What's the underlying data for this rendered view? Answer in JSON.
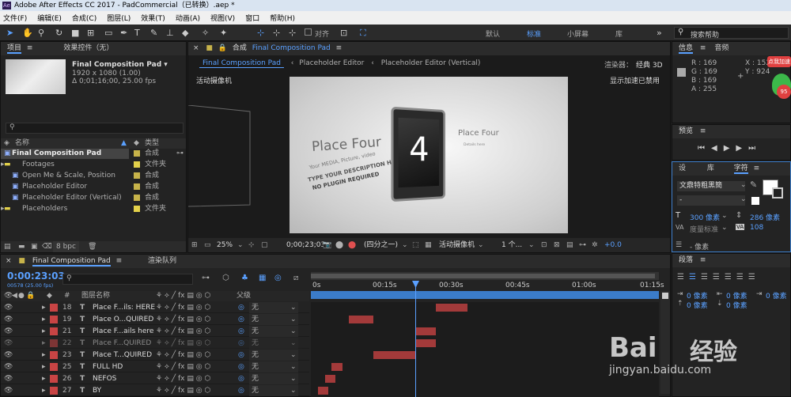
{
  "window": {
    "title": "Adobe After Effects CC 2017 - PadCommercial（已转换）.aep *"
  },
  "menu": [
    "文件(F)",
    "编辑(E)",
    "合成(C)",
    "图层(L)",
    "效果(T)",
    "动画(A)",
    "视图(V)",
    "窗口",
    "帮助(H)"
  ],
  "toolbar": {
    "align_label": "对齐",
    "workspaces": [
      "默认",
      "标准",
      "小屏幕",
      "库"
    ],
    "search_placeholder": "搜索帮助"
  },
  "project": {
    "tab_project": "项目",
    "tab_effects": "效果控件（无）",
    "comp_name": "Final Composition Pad ▾",
    "comp_res": "1920 x 1080 (1.00)",
    "comp_dur": "Δ 0;01;16;00, 25.00 fps",
    "col_name": "名称",
    "col_type": "类型",
    "bpc": "8 bpc",
    "items": [
      {
        "name": "Final Composition Pad",
        "type": "合成",
        "color": "#c7b34a"
      },
      {
        "name": "Footages",
        "type": "文件夹",
        "color": "#e3d14a"
      },
      {
        "name": "Open Me & Scale, Position",
        "type": "合成",
        "color": "#c7b34a"
      },
      {
        "name": "Placeholder Editor",
        "type": "合成",
        "color": "#c7b34a"
      },
      {
        "name": "Placeholder Editor (Vertical)",
        "type": "合成",
        "color": "#c7b34a"
      },
      {
        "name": "Placeholders",
        "type": "文件夹",
        "color": "#e3d14a"
      }
    ]
  },
  "viewer": {
    "comp_label": "合成",
    "comp_tab": "Final Composition Pad",
    "crumb1": "Placeholder Editor",
    "crumb2": "Placeholder Editor (Vertical)",
    "renderer": "渲染器：",
    "renderer_value": "经典 3D",
    "camera_label": "活动摄像机",
    "accel_label": "显示加速已禁用",
    "canvas": {
      "place_four_big": "Place Four",
      "line1": "Your MEDIA, Picture, video",
      "line2": "TYPE YOUR DESCRIPTION HERE",
      "line3": "NO PLUGIN REQUIRED",
      "digit": "4",
      "place_four_small": "Place Four",
      "details": "Details here"
    },
    "footer": {
      "zoom": "25%",
      "time": "0;00;23;03",
      "resolution": "(四分之一)",
      "camera": "活动摄像机",
      "views": "1 个...",
      "offset": "+0.0"
    }
  },
  "info": {
    "tab_info": "信息",
    "tab_audio": "音频",
    "r": "R : 169",
    "g": "G : 169",
    "b": "B : 169",
    "a": "A : 255",
    "x": "X : 152",
    "y": "Y : 924"
  },
  "preview": {
    "title": "预览"
  },
  "character": {
    "tab1": "设",
    "tab2": "库",
    "tab3": "字符",
    "font": "文鼎特粗黑簡",
    "style": "-",
    "size": "300 像素",
    "leading": "286 像素",
    "kerning": "度量标准",
    "tracking": "108",
    "stroke": "- 像素"
  },
  "paragraph": {
    "title": "段落",
    "v1": "0 像素",
    "v2": "0 像素",
    "v3": "0 像素",
    "v4": "0 像素",
    "v5": "0 像素"
  },
  "timeline": {
    "tab": "Final Composition Pad",
    "tab2": "渲染队列",
    "time": "0:00:23:03",
    "frames": "00578 (25.00 fps)",
    "col_layer": "图层名称",
    "col_parent": "父级",
    "ruler": [
      "0s",
      "00:15s",
      "00:30s",
      "00:45s",
      "01:00s",
      "01:15s"
    ],
    "layers": [
      {
        "num": "18",
        "name": "Place F...ils: HERE",
        "parent": "无",
        "bar_start": 0.36,
        "bar_end": 0.45
      },
      {
        "num": "19",
        "name": "Place O...QUIRED",
        "parent": "无",
        "bar_start": 0.11,
        "bar_end": 0.18
      },
      {
        "num": "21",
        "name": "Place F...ails here",
        "parent": "无",
        "bar_start": 0.3,
        "bar_end": 0.36
      },
      {
        "num": "22",
        "name": "Place F...QUIRED",
        "parent": "无",
        "bar_start": 0.3,
        "bar_end": 0.36
      },
      {
        "num": "23",
        "name": "Place T...QUIRED",
        "parent": "无",
        "bar_start": 0.18,
        "bar_end": 0.3
      },
      {
        "num": "25",
        "name": "FULL HD",
        "parent": "无",
        "bar_start": 0.06,
        "bar_end": 0.09
      },
      {
        "num": "26",
        "name": "NEFOS",
        "parent": "无",
        "bar_start": 0.04,
        "bar_end": 0.07
      },
      {
        "num": "27",
        "name": "BY",
        "parent": "无",
        "bar_start": 0.02,
        "bar_end": 0.05
      }
    ],
    "playhead": 0.3
  },
  "watermark": {
    "brand": "Bai",
    "brand2": "经验",
    "url": "jingyan.baidu.com",
    "badge": "点我加速",
    "badge_num": "95"
  }
}
